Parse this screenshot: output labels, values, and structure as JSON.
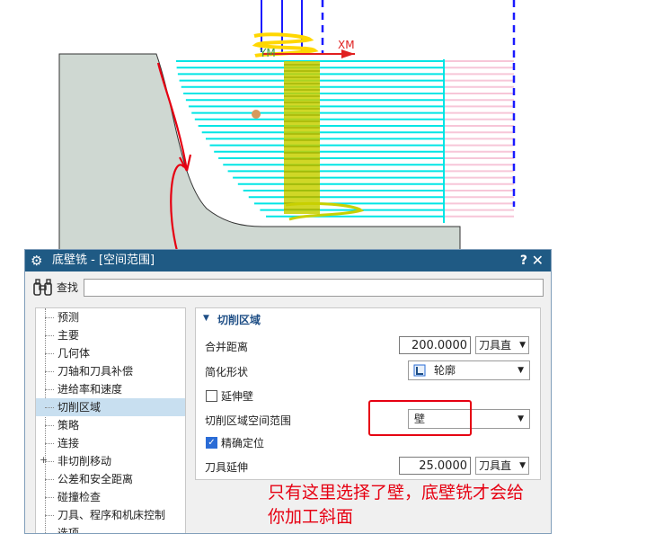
{
  "viewport": {
    "axis_x_label": "XM",
    "axis_y_label": "YM",
    "colors": {
      "part_fill": "#cfd8d2",
      "toolpath": "#00e5e5",
      "toolpath_ghost": "#f7c6d8",
      "tool": "#c8d000",
      "tool_holder": "#ffd700",
      "axis": "#1a1aff",
      "annotation": "#e60012"
    }
  },
  "dialog": {
    "title": "底壁铣 - [空间范围]",
    "help": "?",
    "close": "✕",
    "search_label": "查找",
    "search_value": ""
  },
  "nav": {
    "items": [
      {
        "label": "预测"
      },
      {
        "label": "主要"
      },
      {
        "label": "几何体"
      },
      {
        "label": "刀轴和刀具补偿"
      },
      {
        "label": "进给率和速度"
      },
      {
        "label": "切削区域",
        "selected": true
      },
      {
        "label": "策略"
      },
      {
        "label": "连接"
      },
      {
        "label": "非切削移动",
        "expandable": true,
        "expander": "+"
      },
      {
        "label": "公差和安全距离"
      },
      {
        "label": "碰撞检查"
      },
      {
        "label": "刀具、程序和机床控制"
      },
      {
        "label": "选项"
      }
    ]
  },
  "panel": {
    "section_title": "切削区域",
    "merge_distance": {
      "label": "合并距离",
      "value": "200.0000",
      "unit": "刀具直"
    },
    "simplify_shape": {
      "label": "简化形状",
      "value": "轮廓"
    },
    "extend_wall": {
      "label": "延伸壁",
      "checked": false
    },
    "space_range": {
      "label": "切削区域空间范围",
      "value": "壁"
    },
    "precise_locate": {
      "label": "精确定位",
      "checked": true
    },
    "tool_extend": {
      "label": "刀具延伸",
      "value": "25.0000",
      "unit": "刀具直"
    }
  },
  "annotation": {
    "line1": "只有这里选择了壁，底壁铣才会给",
    "line2": "你加工斜面"
  }
}
